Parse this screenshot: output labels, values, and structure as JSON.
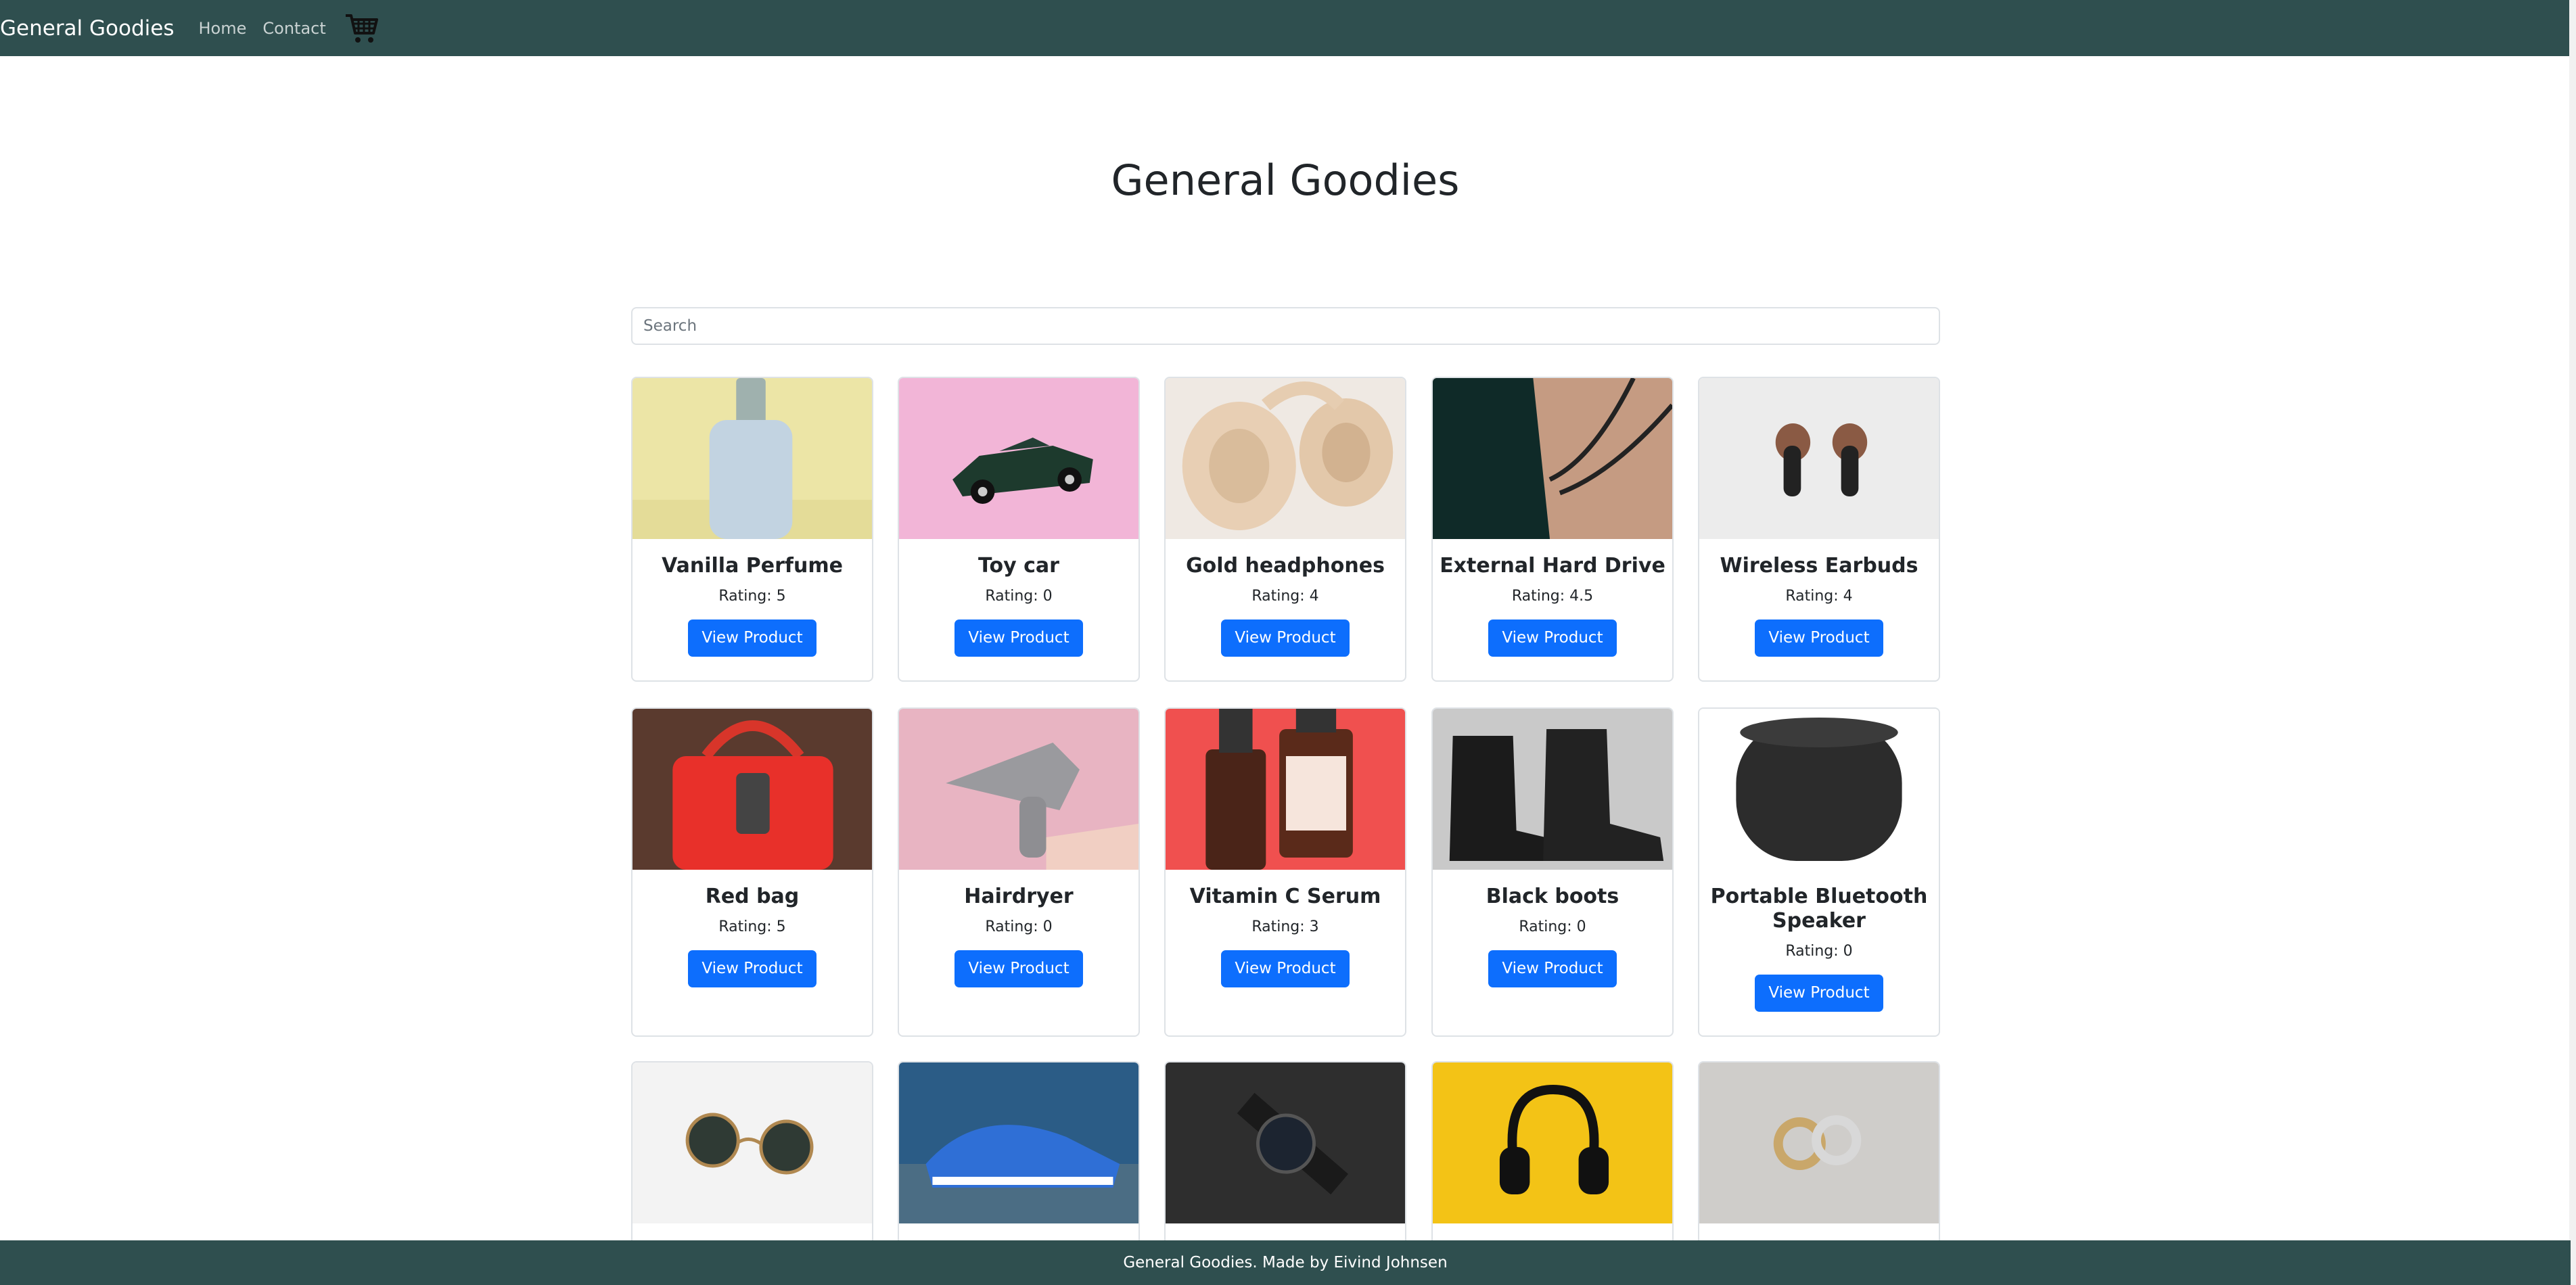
{
  "navbar": {
    "brand": "General Goodies",
    "links": [
      "Home",
      "Contact"
    ],
    "cart_icon": "shopping-cart-icon"
  },
  "page": {
    "title": "General Goodies"
  },
  "search": {
    "placeholder": "Search",
    "value": ""
  },
  "products": [
    {
      "name": "Vanilla Perfume",
      "rating": "Rating: 5",
      "button": "View Product"
    },
    {
      "name": "Toy car",
      "rating": "Rating: 0",
      "button": "View Product"
    },
    {
      "name": "Gold headphones",
      "rating": "Rating: 4",
      "button": "View Product"
    },
    {
      "name": "External Hard Drive",
      "rating": "Rating: 4.5",
      "button": "View Product"
    },
    {
      "name": "Wireless Earbuds",
      "rating": "Rating: 4",
      "button": "View Product"
    },
    {
      "name": "Red bag",
      "rating": "Rating: 5",
      "button": "View Product"
    },
    {
      "name": "Hairdryer",
      "rating": "Rating: 0",
      "button": "View Product"
    },
    {
      "name": "Vitamin C Serum",
      "rating": "Rating: 3",
      "button": "View Product"
    },
    {
      "name": "Black boots",
      "rating": "Rating: 0",
      "button": "View Product"
    },
    {
      "name": "Portable Bluetooth Speaker",
      "rating": "Rating: 0",
      "button": "View Product"
    }
  ],
  "footer": {
    "text": "General Goodies. Made by Eivind Johnsen"
  },
  "colors": {
    "navbar": "#2f4f4f",
    "button": "#0d6efd",
    "card_border": "#dee2e6"
  }
}
